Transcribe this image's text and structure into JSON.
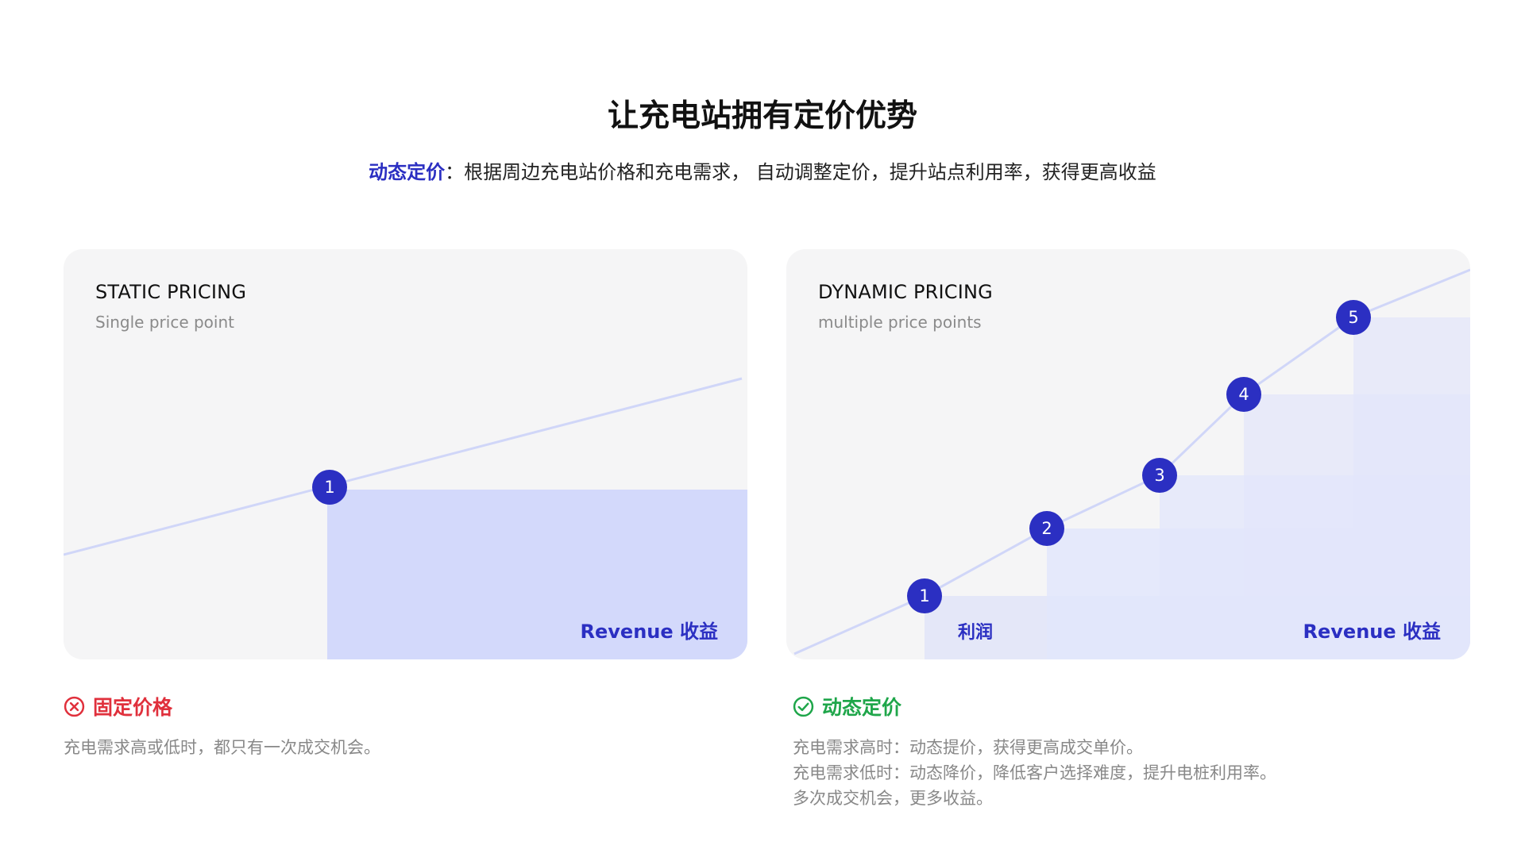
{
  "header": {
    "title": "让充电站拥有定价优势",
    "subtitle_highlight": "动态定价",
    "subtitle_rest": "：根据周边充电站价格和充电需求， 自动调整定价，提升站点利用率，获得更高收益"
  },
  "colors": {
    "accent": "#2b2fc2",
    "revenue_fill": "#d3d9fb",
    "line": "#d0d6f8",
    "card_bg": "#f5f5f6",
    "negative": "#e0303c",
    "positive": "#1fa64a"
  },
  "static_card": {
    "title": "STATIC PRICING",
    "subtitle": "Single price point",
    "revenue_label": "Revenue 收益",
    "points": [
      {
        "label": "1"
      }
    ]
  },
  "dynamic_card": {
    "title": "DYNAMIC PRICING",
    "subtitle": "multiple price points",
    "profit_label": "利润",
    "revenue_label": "Revenue 收益",
    "points": [
      {
        "label": "1"
      },
      {
        "label": "2"
      },
      {
        "label": "3"
      },
      {
        "label": "4"
      },
      {
        "label": "5"
      }
    ]
  },
  "notes": {
    "static": {
      "icon": "x-circle-icon",
      "heading": "固定价格",
      "lines": [
        "充电需求高或低时，都只有一次成交机会。"
      ]
    },
    "dynamic": {
      "icon": "check-circle-icon",
      "heading": "动态定价",
      "lines": [
        "充电需求高时：动态提价，获得更高成交单价。",
        "充电需求低时：动态降价，降低客户选择难度，提升电桩利用率。",
        "多次成交机会，更多收益。"
      ]
    }
  }
}
